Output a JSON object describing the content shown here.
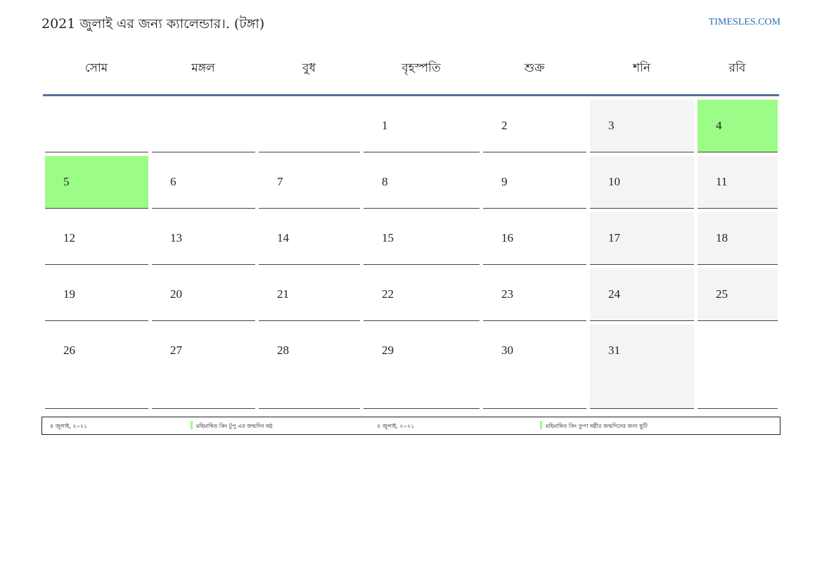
{
  "title": "2021 জুলাই এর জন্য ক্যালেন্ডার।. (টঙ্গা)",
  "site": "TIMESLES.COM",
  "weekdays": [
    "সোম",
    "মঙ্গল",
    "বুধ",
    "বৃহস্পতি",
    "শুক্র",
    "শনি",
    "রবি"
  ],
  "weeks": [
    [
      "",
      "",
      "",
      "1",
      "2",
      "3",
      "4"
    ],
    [
      "5",
      "6",
      "7",
      "8",
      "9",
      "10",
      "11"
    ],
    [
      "12",
      "13",
      "14",
      "15",
      "16",
      "17",
      "18"
    ],
    [
      "19",
      "20",
      "21",
      "22",
      "23",
      "24",
      "25"
    ],
    [
      "26",
      "27",
      "28",
      "29",
      "30",
      "31",
      ""
    ]
  ],
  "colors": {
    "weekend": "#f4f4f4",
    "holiday": "#9bfc87",
    "header_rule": "#5b7196",
    "link": "#2a6fb0"
  },
  "holidays": [
    {
      "date": "৪ জুলাই, ২০২১",
      "name": "মহিমান্বিত কিং টুপু এর জন্মদিন ষষ্ঠ"
    },
    {
      "date": "৫ জুলাই, ২০২১",
      "name": "মহিমান্বিত কিং তুপা ষষ্ঠীর জন্মদিনের জন্য ছুটি"
    }
  ]
}
